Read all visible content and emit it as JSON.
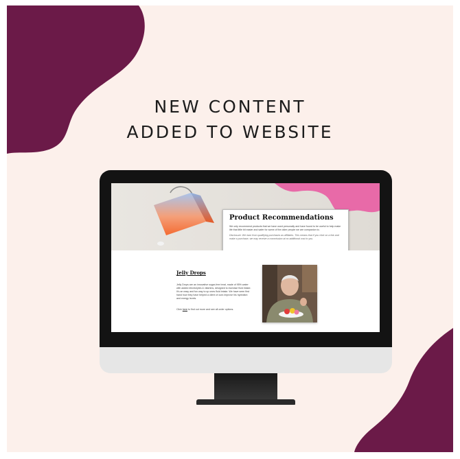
{
  "headline": {
    "line1": "NEW CONTENT",
    "line2": "ADDED TO WEBSITE"
  },
  "website": {
    "hero_card": {
      "title": "Product Recommendations",
      "intro": "We only recommend products that we have used personally and have found to be useful to help make life that little bit easier and safer for some of the older people we are companion to.",
      "disclosure": "Disclosure: We earn from qualifying purchases as affiliates. This means that if you click on a link and make a purchase, we may receive a commission at no additional cost to you."
    },
    "product": {
      "title": "Jelly Drops",
      "description": "Jelly Drops are an innovative sugar-free treat, made of 95% water with added electrolytes & vitamins, designed to increase fluid intake. It's an easy and fun way to up ones fluid intake. We have seen first hand how they have helped a client of ours improve his hydration and energy levels.",
      "link_prefix": "Click ",
      "link_text": "here",
      "link_suffix": " to find out more and see all order options."
    }
  },
  "colors": {
    "background": "#fcf0eb",
    "accent_blob": "#6b1a48",
    "monitor_bezel": "#131313",
    "monitor_chin": "#e6e6e6"
  }
}
